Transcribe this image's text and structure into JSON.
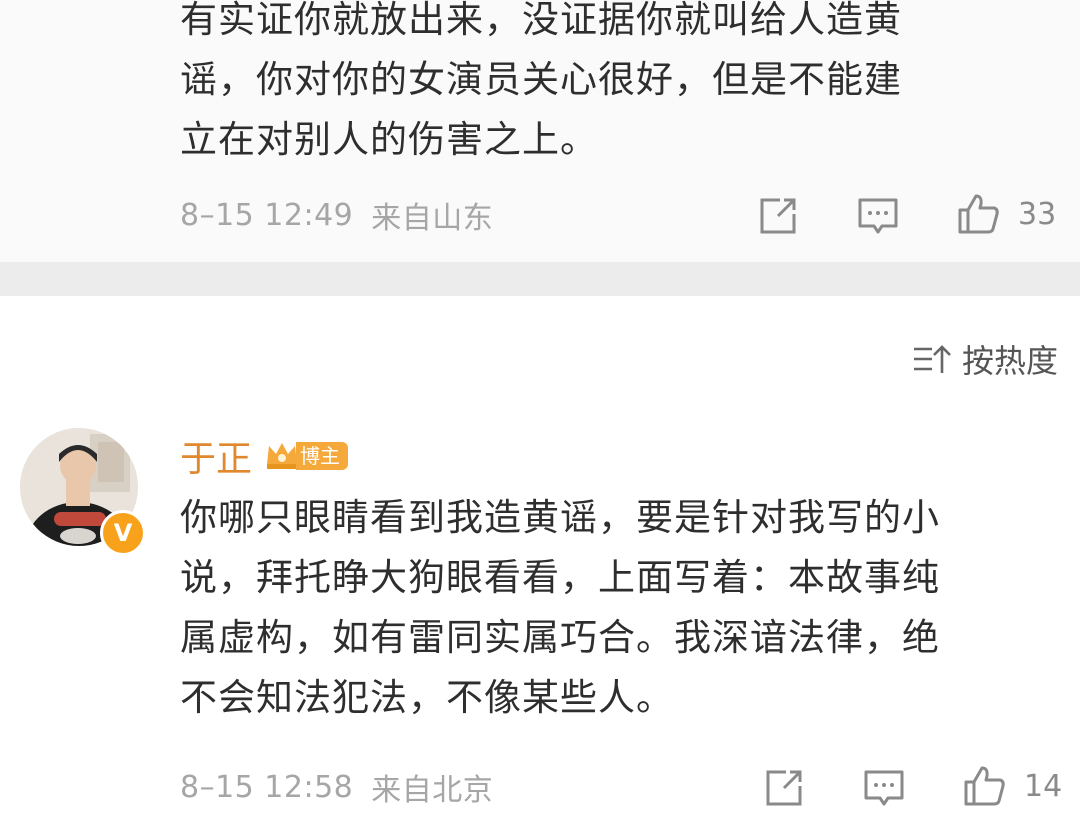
{
  "previous_comment": {
    "lines": [
      "有实证你就放出来，没证据你就叫给人造黄",
      "谣，你对你的女演员关心很好，但是不能建",
      "立在对别人的伤害之上。"
    ],
    "time": "8–15 12:49",
    "location": "来自山东",
    "likes": "33"
  },
  "sort": {
    "label": "按热度",
    "icon": "sort-icon"
  },
  "reply": {
    "author": "于正",
    "badge": "博主",
    "verified": "V",
    "lines": [
      "你哪只眼睛看到我造黄谣，要是针对我写的小",
      "说，拜托睁大狗眼看看，上面写着：本故事纯",
      "属虚构，如有雷同实属巧合。我深谙法律，绝",
      "不会知法犯法，不像某些人。"
    ],
    "time": "8–15 12:58",
    "location": "来自北京",
    "likes": "14"
  },
  "colors": {
    "author": "#e0882e",
    "badge": "#f4a93a",
    "verified": "#f8a21c",
    "meta": "#a6a6a6"
  }
}
